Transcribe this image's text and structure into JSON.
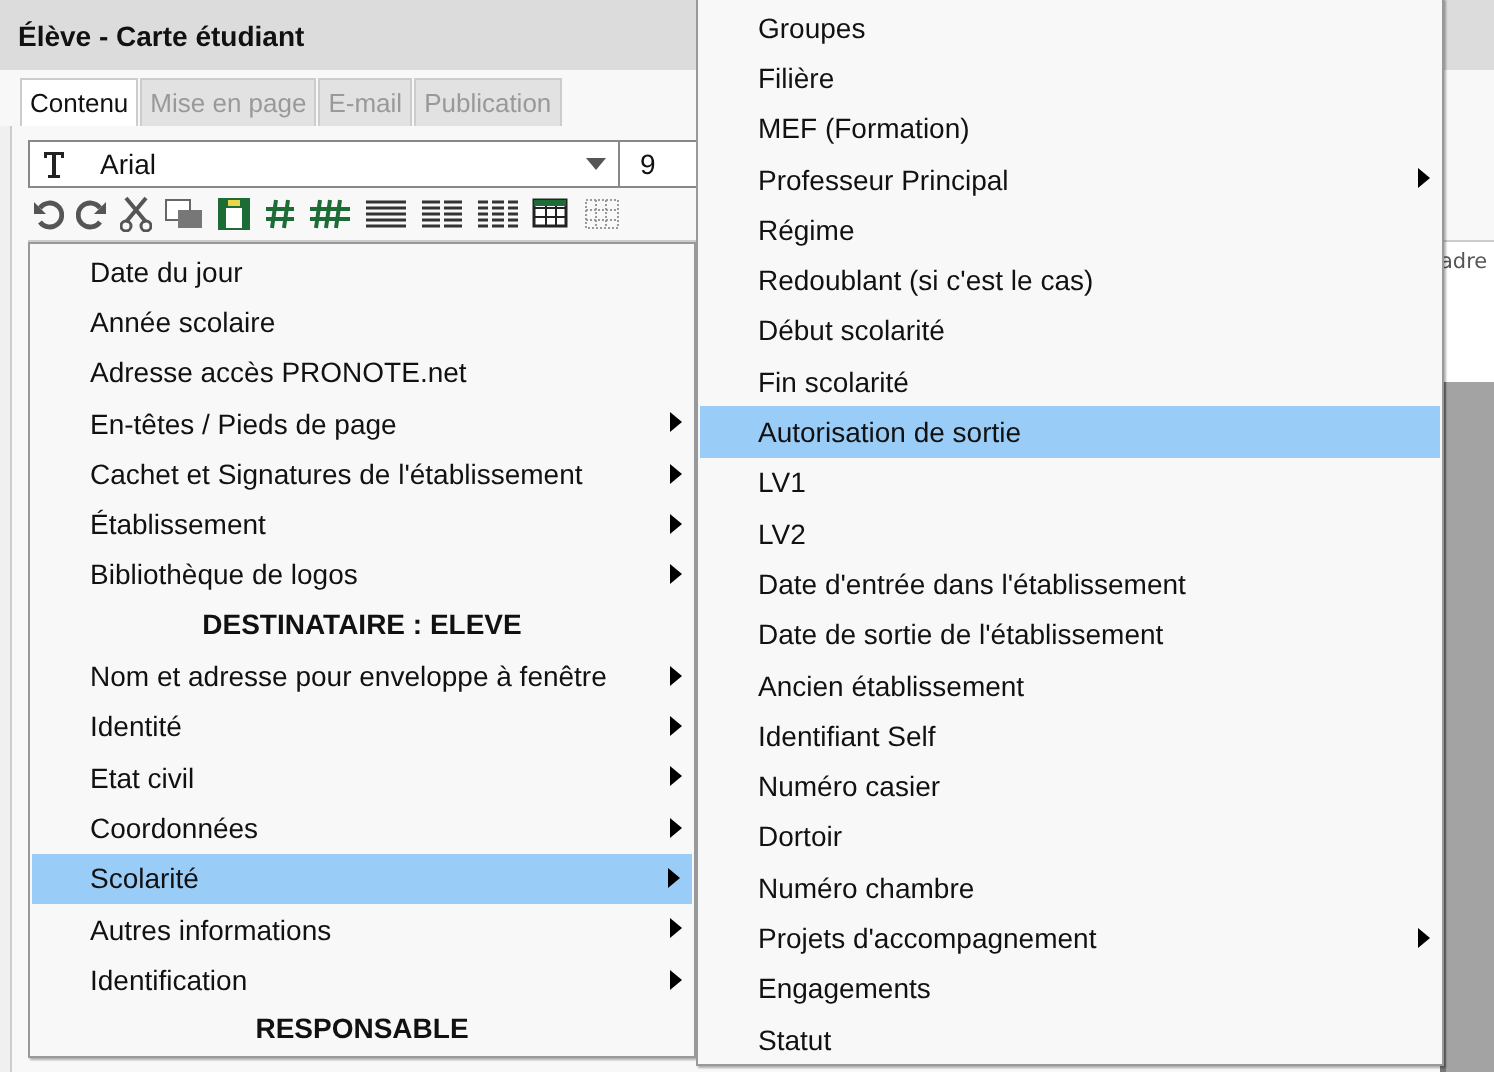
{
  "window": {
    "title": "Élève - Carte étudiant"
  },
  "tabs": [
    {
      "label": "Contenu",
      "selected": true
    },
    {
      "label": "Mise en page",
      "selected": false
    },
    {
      "label": "E-mail",
      "selected": false
    },
    {
      "label": "Publication",
      "selected": false
    }
  ],
  "font_select": {
    "value": "Arial"
  },
  "size_select": {
    "value": "9"
  },
  "background_text": "adre",
  "menus": [
    {
      "items": [
        {
          "kind": "item",
          "label": "Date du jour",
          "submenu": false,
          "selected": false
        },
        {
          "kind": "item",
          "label": "Année scolaire",
          "submenu": false,
          "selected": false
        },
        {
          "kind": "item",
          "label": "Adresse accès PRONOTE.net",
          "submenu": false,
          "selected": false
        },
        {
          "kind": "item",
          "label": "En-têtes / Pieds de page",
          "submenu": true,
          "selected": false
        },
        {
          "kind": "item",
          "label": "Cachet et Signatures de l'établissement",
          "submenu": true,
          "selected": false
        },
        {
          "kind": "item",
          "label": "Établissement",
          "submenu": true,
          "selected": false
        },
        {
          "kind": "item",
          "label": "Bibliothèque de logos",
          "submenu": true,
          "selected": false
        },
        {
          "kind": "header",
          "label": "DESTINATAIRE : ELEVE"
        },
        {
          "kind": "item",
          "label": "Nom et adresse pour enveloppe à fenêtre",
          "submenu": true,
          "selected": false
        },
        {
          "kind": "item",
          "label": "Identité",
          "submenu": true,
          "selected": false
        },
        {
          "kind": "item",
          "label": "Etat civil",
          "submenu": true,
          "selected": false
        },
        {
          "kind": "item",
          "label": "Coordonnées",
          "submenu": true,
          "selected": false
        },
        {
          "kind": "item",
          "label": "Scolarité",
          "submenu": true,
          "selected": true
        },
        {
          "kind": "item",
          "label": "Autres informations",
          "submenu": true,
          "selected": false
        },
        {
          "kind": "item",
          "label": "Identification",
          "submenu": true,
          "selected": false
        },
        {
          "kind": "header",
          "label": "RESPONSABLE"
        }
      ]
    },
    {
      "items": [
        {
          "kind": "item",
          "label": "Groupes",
          "submenu": false,
          "selected": false
        },
        {
          "kind": "item",
          "label": "Filière",
          "submenu": false,
          "selected": false
        },
        {
          "kind": "item",
          "label": "MEF (Formation)",
          "submenu": false,
          "selected": false
        },
        {
          "kind": "item",
          "label": "Professeur Principal",
          "submenu": true,
          "selected": false
        },
        {
          "kind": "item",
          "label": "Régime",
          "submenu": false,
          "selected": false
        },
        {
          "kind": "item",
          "label": "Redoublant (si c'est le cas)",
          "submenu": false,
          "selected": false
        },
        {
          "kind": "item",
          "label": "Début scolarité",
          "submenu": false,
          "selected": false
        },
        {
          "kind": "item",
          "label": "Fin scolarité",
          "submenu": false,
          "selected": false
        },
        {
          "kind": "item",
          "label": "Autorisation de sortie",
          "submenu": false,
          "selected": true
        },
        {
          "kind": "item",
          "label": "LV1",
          "submenu": false,
          "selected": false
        },
        {
          "kind": "item",
          "label": "LV2",
          "submenu": false,
          "selected": false
        },
        {
          "kind": "item",
          "label": "Date d'entrée dans l'établissement",
          "submenu": false,
          "selected": false
        },
        {
          "kind": "item",
          "label": "Date de sortie de l'établissement",
          "submenu": false,
          "selected": false
        },
        {
          "kind": "item",
          "label": "Ancien établissement",
          "submenu": false,
          "selected": false
        },
        {
          "kind": "item",
          "label": "Identifiant Self",
          "submenu": false,
          "selected": false
        },
        {
          "kind": "item",
          "label": "Numéro casier",
          "submenu": false,
          "selected": false
        },
        {
          "kind": "item",
          "label": "Dortoir",
          "submenu": false,
          "selected": false
        },
        {
          "kind": "item",
          "label": "Numéro chambre",
          "submenu": false,
          "selected": false
        },
        {
          "kind": "item",
          "label": "Projets d'accompagnement",
          "submenu": true,
          "selected": false
        },
        {
          "kind": "item",
          "label": "Engagements",
          "submenu": false,
          "selected": false
        },
        {
          "kind": "item",
          "label": "Statut",
          "submenu": false,
          "selected": false
        }
      ]
    }
  ]
}
